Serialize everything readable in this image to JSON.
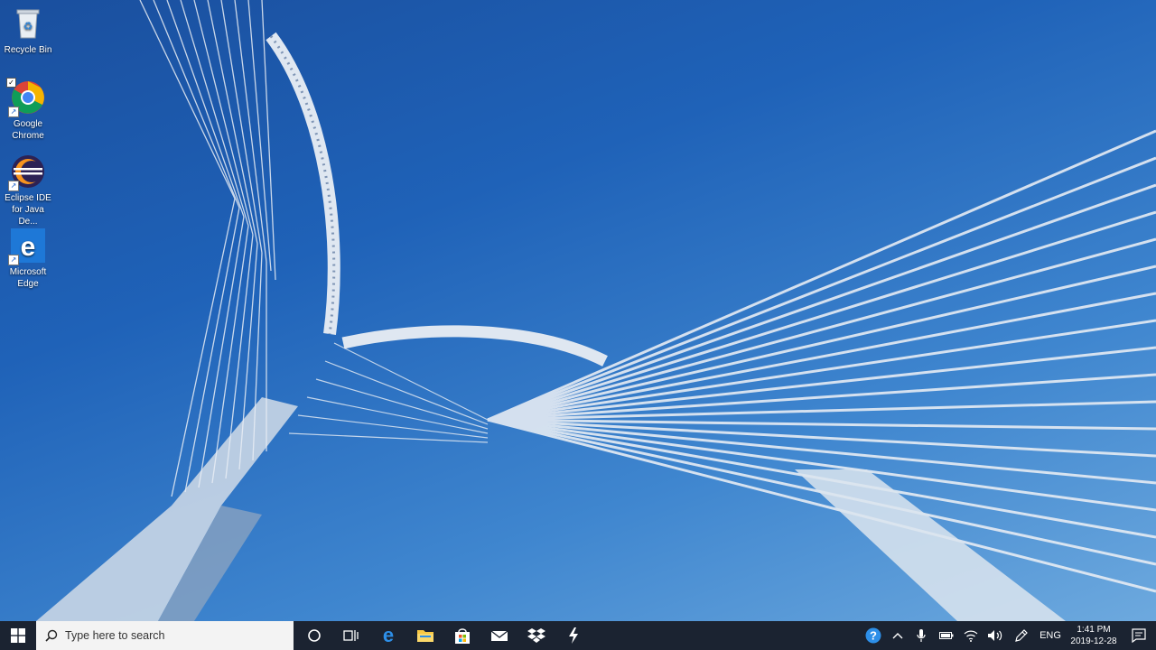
{
  "desktop": {
    "icons": [
      {
        "label": "Recycle Bin"
      },
      {
        "label": "Google Chrome"
      },
      {
        "label": "Eclipse IDE for Java De..."
      },
      {
        "label": "Microsoft Edge"
      }
    ]
  },
  "taskbar": {
    "search_placeholder": "Type here to search",
    "pinned_apps": [
      "cortana-icon",
      "task-view-icon",
      "edge-icon",
      "file-explorer-icon",
      "store-icon",
      "mail-icon",
      "dropbox-icon",
      "lightning-app-icon"
    ],
    "tray": {
      "language": "ENG",
      "time": "1:41 PM",
      "date": "2019-12-28"
    }
  },
  "colors": {
    "taskbar": "#1b2331",
    "sky_top": "#1a4f9e",
    "sky_bottom": "#6da9de"
  }
}
